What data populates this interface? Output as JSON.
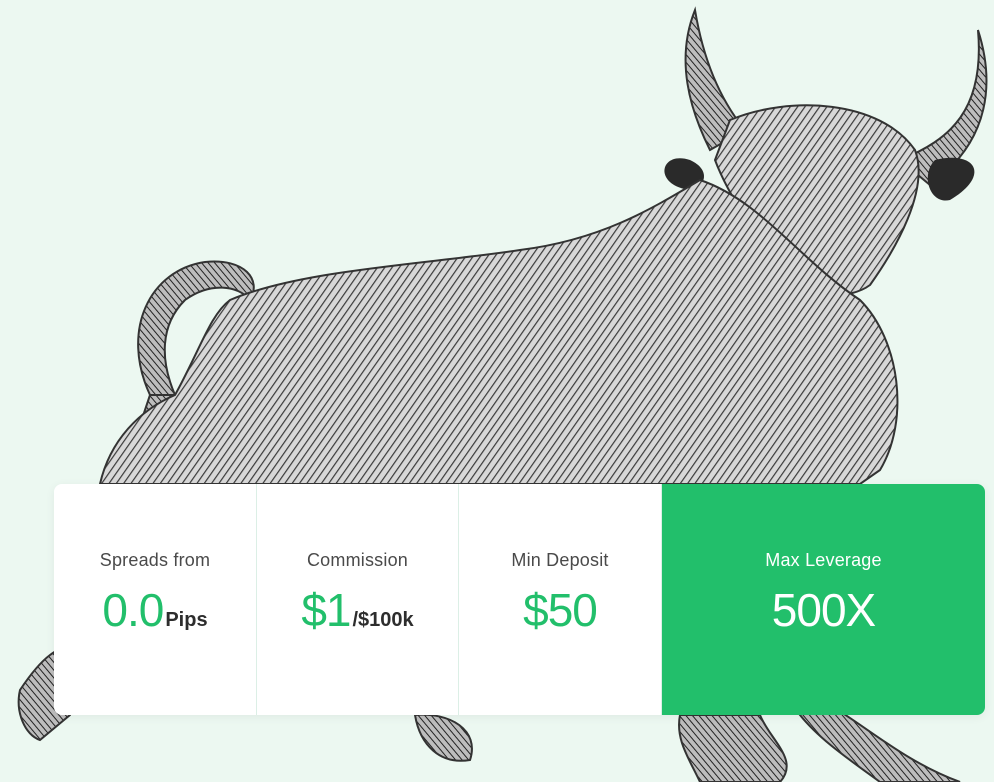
{
  "stats": [
    {
      "label": "Spreads from",
      "value": "0.0",
      "suffix": "Pips"
    },
    {
      "label": "Commission",
      "value": "$1",
      "suffix": "/$100k"
    },
    {
      "label": "Min Deposit",
      "value": "$50",
      "suffix": ""
    },
    {
      "label": "Max Leverage",
      "value": "500X",
      "suffix": ""
    }
  ],
  "colors": {
    "accent": "#22bf6b",
    "background": "#ecf8f1",
    "card": "#ffffff",
    "text": "#4a4a4a"
  },
  "hero_image": "bull-engraving-illustration"
}
